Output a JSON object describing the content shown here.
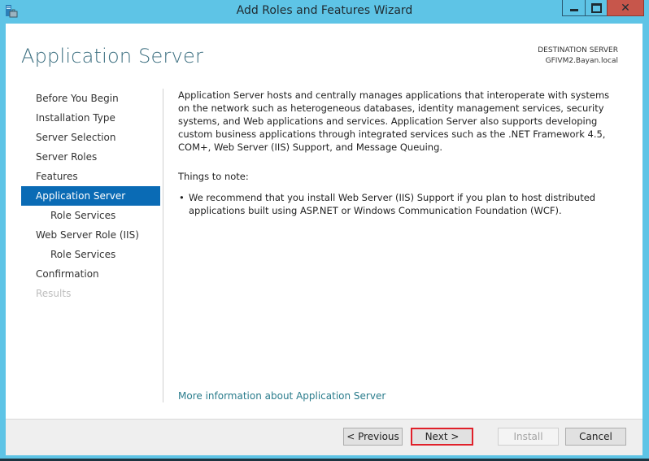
{
  "window": {
    "title": "Add Roles and Features Wizard",
    "controls": {
      "minimize": "minimize",
      "maximize": "maximize",
      "close": "✕"
    }
  },
  "header": {
    "page_title": "Application Server",
    "destination_label": "DESTINATION SERVER",
    "destination_server": "GFIVM2.Bayan.local"
  },
  "nav": {
    "items": [
      {
        "label": "Before You Begin",
        "state": "normal",
        "level": 0
      },
      {
        "label": "Installation Type",
        "state": "normal",
        "level": 0
      },
      {
        "label": "Server Selection",
        "state": "normal",
        "level": 0
      },
      {
        "label": "Server Roles",
        "state": "normal",
        "level": 0
      },
      {
        "label": "Features",
        "state": "normal",
        "level": 0
      },
      {
        "label": "Application Server",
        "state": "active",
        "level": 0
      },
      {
        "label": "Role Services",
        "state": "normal",
        "level": 1
      },
      {
        "label": "Web Server Role (IIS)",
        "state": "normal",
        "level": 0
      },
      {
        "label": "Role Services",
        "state": "normal",
        "level": 1
      },
      {
        "label": "Confirmation",
        "state": "normal",
        "level": 0
      },
      {
        "label": "Results",
        "state": "disabled",
        "level": 0
      }
    ]
  },
  "content": {
    "description": "Application Server hosts and centrally manages applications that interoperate with systems on the network such as heterogeneous databases, identity management services, security systems, and Web applications and services. Application Server also supports developing custom business applications through integrated services such as the .NET Framework 4.5, COM+, Web Server (IIS) Support, and Message Queuing.",
    "notes_heading": "Things to note:",
    "notes": [
      "We recommend that you install Web Server (IIS) Support if you plan to host distributed applications built using ASP.NET or Windows Communication Foundation (WCF)."
    ],
    "more_info_link": "More information about Application Server"
  },
  "footer": {
    "previous_label": "< Previous",
    "next_label": "Next >",
    "install_label": "Install",
    "cancel_label": "Cancel"
  },
  "colors": {
    "titlebar": "#5ec4e6",
    "active_nav": "#0a6bb5",
    "close_button": "#c7564b",
    "link": "#2a7c8c",
    "next_highlight": "#e0202a"
  }
}
